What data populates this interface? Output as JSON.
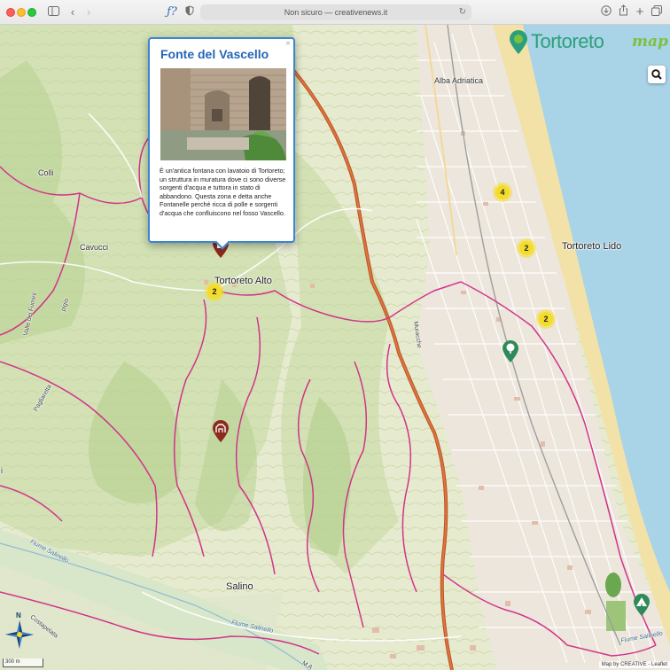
{
  "browser": {
    "url_text": "Non sicuro — creativenews.it",
    "icons": [
      "close-dot",
      "minimize-dot",
      "zoom-dot",
      "sidebar-icon",
      "back-icon",
      "forward-icon",
      "formula-extension-icon",
      "shield-icon",
      "reload-icon",
      "download-icon",
      "share-icon",
      "new-tab-icon",
      "tabs-overview-icon"
    ]
  },
  "logo": {
    "name": "Tortoreto",
    "suffix": "map",
    "icon": "map-pin-logo-icon"
  },
  "search_button": {
    "icon": "search-icon"
  },
  "popup": {
    "title": "Fonte del Vascello",
    "close_label": "×",
    "description": "È un'antica fontana con lavatoio di Tortoreto; un struttura in muratura dove ci sono diverse sorgenti d'acqua e tuttora in stato di abbandono. Questa zona e detta anche Fontanelle perchè ricca di polle e sorgenti d'acqua che confluiscono nel fosso Vascello."
  },
  "places": {
    "alba_adriatica": "Alba Adriatica",
    "tortoreto_lido": "Tortoreto Lido",
    "tortoreto_alto": "Tortoreto Alto",
    "colli": "Colli",
    "cavucci": "Cavucci",
    "salino": "Salino",
    "muracche": "Muracche",
    "valle_dei_fumini": "Valle dei Fumini",
    "pigio": "pigio",
    "pagliaretta": "Pagliaretta",
    "costapelata": "Costapelata",
    "fiume_salinello_1": "Fiume Salinello",
    "fiume_salinello_2": "Fiume Salinello",
    "fiume_salinello_3": "Fiume Salinello",
    "edge_i": "i",
    "edge_ma": "M A"
  },
  "clusters": [
    {
      "name": "cluster-4",
      "count": "4"
    },
    {
      "name": "cluster-2-lido",
      "count": "2"
    },
    {
      "name": "cluster-2-south",
      "count": "2"
    },
    {
      "name": "cluster-2-alto",
      "count": "2"
    }
  ],
  "markers": [
    {
      "name": "fountain-marker",
      "color": "#8b2a1e",
      "icon": "fountain-icon"
    },
    {
      "name": "monument-marker",
      "color": "#8b2a1e",
      "icon": "ruins-icon"
    },
    {
      "name": "park-marker",
      "color": "#2f8a5a",
      "icon": "tree-icon"
    },
    {
      "name": "camping-marker",
      "color": "#2f8a5a",
      "icon": "tent-icon"
    }
  ],
  "scale": {
    "label": "300 m"
  },
  "attribution": "Map by CREATIVE - Leaflet",
  "compass": {
    "north_label": "N",
    "icon": "compass-rose-icon"
  },
  "colors": {
    "sea": "#a9d3e6",
    "beach": "#f2e2a8",
    "land": "#e6ebcf",
    "trail": "#d2338a",
    "highway": "#d9622b",
    "accent": "#3a86d1",
    "logo": "#2b9f7b"
  }
}
